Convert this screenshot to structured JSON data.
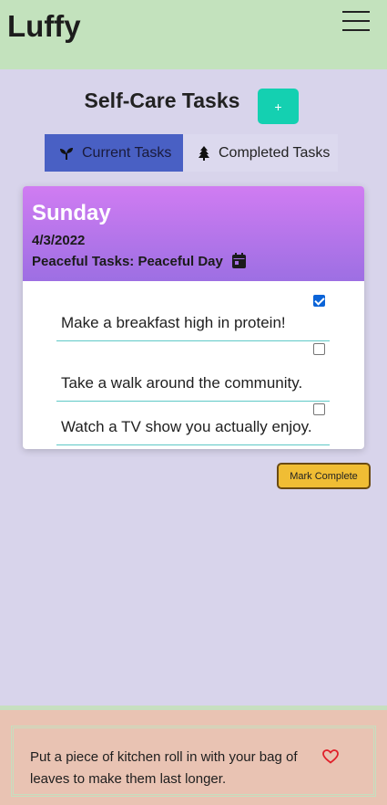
{
  "navbar": {
    "brand": "Luffy",
    "menu_icon": "hamburger-menu-icon"
  },
  "page": {
    "title": "Self-Care Tasks",
    "add_button_label": "+"
  },
  "tabs": [
    {
      "label": "Current Tasks",
      "icon": "seedling-icon",
      "active": true
    },
    {
      "label": "Completed Tasks",
      "icon": "tree-icon",
      "active": false
    }
  ],
  "day_card": {
    "day": "Sunday",
    "date": "4/3/2022",
    "theme": "Peaceful Tasks: Peaceful Day",
    "theme_icon": "calendar-icon",
    "header_colors": [
      "#d07cf2",
      "#9d6fe3"
    ],
    "tasks": [
      {
        "text": "Make a breakfast high in protein!",
        "checked": true
      },
      {
        "text": "Take a walk around the community.",
        "checked": false
      },
      {
        "text": "Watch a TV show you actually enjoy.",
        "checked": false
      }
    ]
  },
  "actions": {
    "mark_complete_label": "Mark Complete"
  },
  "footer": {
    "tip": "Put a piece of kitchen roll in with your bag of leaves to make them last longer.",
    "favorite_icon": "heart-icon"
  },
  "colors": {
    "background": "#d8d4eb",
    "navbar": "#c3e2bd",
    "accent_add": "#14d0b1",
    "tab_active": "#4960c4",
    "mark_complete": "#f0bd34",
    "footer": "#e9c3b3",
    "task_divider": "#5fc9c7"
  }
}
